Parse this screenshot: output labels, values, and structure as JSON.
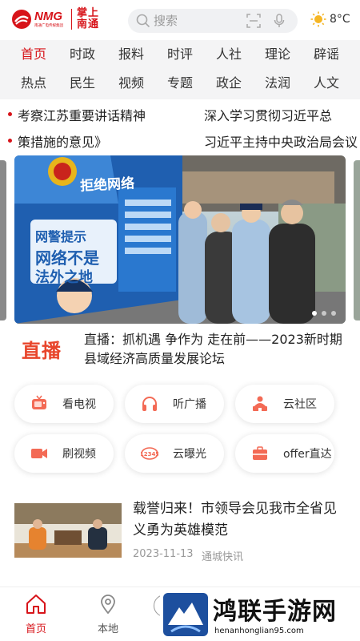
{
  "header": {
    "logo_brand": "NMG",
    "logo_sub": "南通广电传媒集团",
    "logo_app_line1": "掌上",
    "logo_app_line2": "南通",
    "search_placeholder": "搜索",
    "weather_temp": "8°C",
    "weather_icon": "sun-icon"
  },
  "tabs": {
    "row1": [
      "首页",
      "时政",
      "报料",
      "时评",
      "人社",
      "理论",
      "辟谣"
    ],
    "row2": [
      "热点",
      "民生",
      "视频",
      "专题",
      "政企",
      "法润",
      "人文"
    ],
    "active": "首页",
    "active_color": "#d7141a"
  },
  "tickers": [
    {
      "left": "考察江苏重要讲话精神",
      "right": "深入学习贯彻习近平总"
    },
    {
      "left": "策措施的意见》",
      "right": "习近平主持中央政治局会议"
    }
  ],
  "banner": {
    "sign_text_1": "网警提示",
    "sign_text_2": "网络不是",
    "sign_text_3": "法外之地",
    "top_text": "拒绝网络",
    "slides": 3,
    "current_slide": 1
  },
  "live": {
    "badge": "直播",
    "text": "直播：抓机遇 争作为 走在前——2023新时期县域经济高质量发展论坛"
  },
  "quick_buttons": [
    {
      "label": "看电视",
      "icon": "tv-icon"
    },
    {
      "label": "听广播",
      "icon": "headphones-icon"
    },
    {
      "label": "云社区",
      "icon": "community-icon"
    },
    {
      "label": "刷视频",
      "icon": "video-icon"
    },
    {
      "label": "云曝光",
      "icon": "exposure-icon"
    },
    {
      "label": "offer直达",
      "icon": "briefcase-icon"
    }
  ],
  "news": {
    "title": "载誉归来！市领导会见我市全省见义勇为英雄模范",
    "date": "2023-11-13",
    "source": "通城快讯"
  },
  "bottom_nav": [
    {
      "label": "首页",
      "icon": "home-icon",
      "active": true
    },
    {
      "label": "本地",
      "icon": "location-icon",
      "active": false
    }
  ],
  "watermark": {
    "text": "鸿联手游网",
    "url": "henanhonglian95.com"
  },
  "colors": {
    "brand_red": "#d7141a",
    "live_orange": "#e8452b",
    "tab_bg": "#f4f4f5"
  }
}
